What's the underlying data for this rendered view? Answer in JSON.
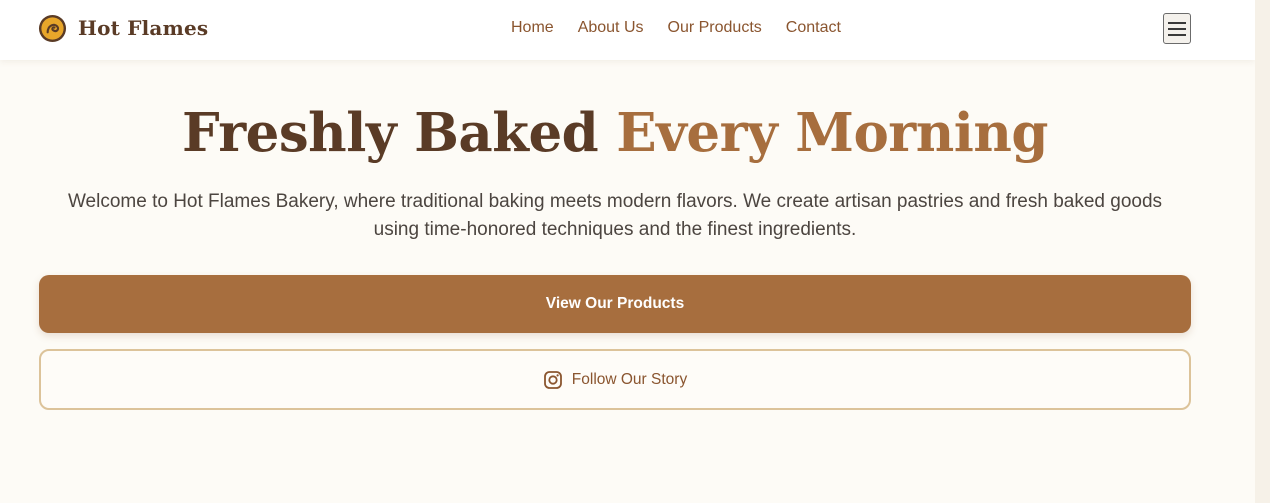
{
  "header": {
    "brand_name": "Hot Flames",
    "logo_icon": "flame-logo-icon",
    "nav_items": [
      {
        "label": "Home"
      },
      {
        "label": "About Us"
      },
      {
        "label": "Our Products"
      },
      {
        "label": "Contact"
      }
    ],
    "menu_icon": "hamburger-menu-icon"
  },
  "hero": {
    "title_main": "Freshly Baked",
    "title_accent": "Every Morning",
    "intro": "Welcome to Hot Flames Bakery, where traditional baking meets modern flavors. We create artisan pastries and fresh baked goods using time-honored techniques and the finest ingredients.",
    "primary_button": "View Our Products",
    "secondary_button": "Follow Our Story",
    "secondary_icon": "instagram-icon"
  },
  "colors": {
    "primary": "#a76e3e",
    "dark_brown": "#5a3b26",
    "link": "#8a552f",
    "background": "#fdfbf6",
    "outline": "#dcc39a",
    "logo_fill": "#e8a62a"
  }
}
